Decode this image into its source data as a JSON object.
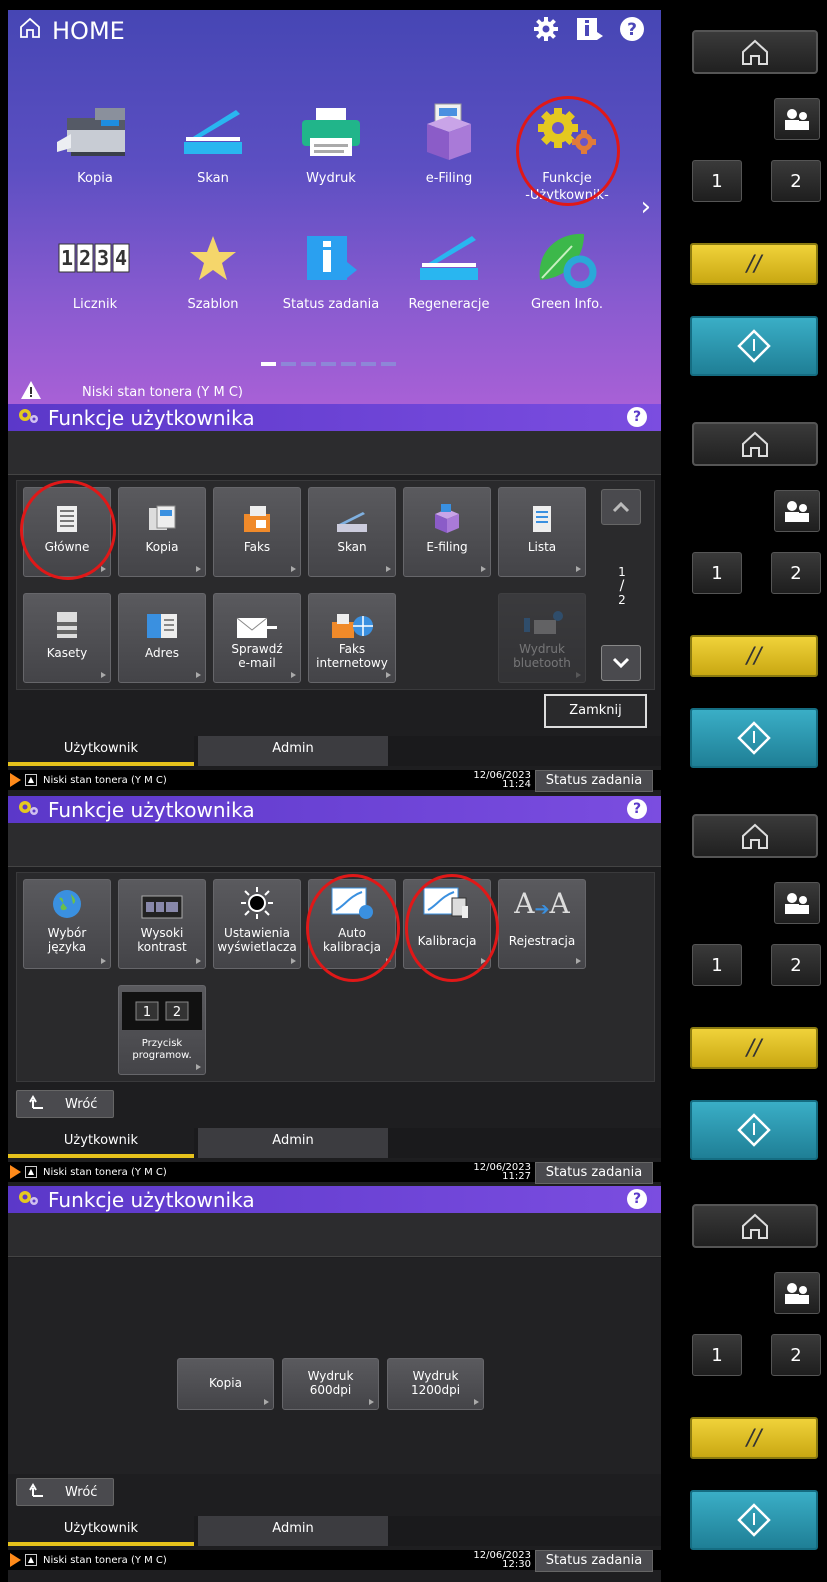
{
  "home": {
    "title": "HOME",
    "tiles": [
      {
        "label": "Kopia",
        "icon": "copier-icon"
      },
      {
        "label": "Skan",
        "icon": "scan-icon"
      },
      {
        "label": "Wydruk",
        "icon": "printer-icon"
      },
      {
        "label": "e-Filing",
        "icon": "efiling-box-icon"
      },
      {
        "label": "Funkcje\n-Użytkownik-",
        "icon": "user-functions-gears-icon"
      },
      {
        "label": "Licznik",
        "icon": "counter-1234-icon"
      },
      {
        "label": "Szablon",
        "icon": "star-icon"
      },
      {
        "label": "Status zadania",
        "icon": "info-icon"
      },
      {
        "label": "Regeneracje",
        "icon": "regenerate-scan-icon"
      },
      {
        "label": "Green Info.",
        "icon": "leaf-icon"
      }
    ],
    "warning": "Niski stan tonera (Y M C)",
    "page_dots": 7,
    "active_dot": 0
  },
  "panel_title": "Funkcje użytkownika",
  "panel1": {
    "buttons": [
      {
        "label": "Główne"
      },
      {
        "label": "Kopia"
      },
      {
        "label": "Faks"
      },
      {
        "label": "Skan"
      },
      {
        "label": "E-filing"
      },
      {
        "label": "Lista"
      },
      {
        "label": "Kasety"
      },
      {
        "label": "Adres"
      },
      {
        "label": "Sprawdź\ne-mail"
      },
      {
        "label": "Faks\ninternetowy"
      },
      {
        "label": "Wydruk\nbluetooth"
      }
    ],
    "page_current": "1",
    "page_total": "2",
    "close_label": "Zamknij",
    "time": "11:24"
  },
  "panel2": {
    "buttons": [
      {
        "label": "Wybór\njęzyka"
      },
      {
        "label": "Wysoki\nkontrast"
      },
      {
        "label": "Ustawienia\nwyświetlacza"
      },
      {
        "label": "Auto\nkalibracja"
      },
      {
        "label": "Kalibracja"
      },
      {
        "label": "Rejestracja"
      },
      {
        "label": "Przycisk\nprogramow."
      }
    ],
    "back_label": "Wróć",
    "time": "11:27"
  },
  "panel3": {
    "buttons": [
      {
        "label": "Kopia"
      },
      {
        "label": "Wydruk\n600dpi"
      },
      {
        "label": "Wydruk\n1200dpi"
      }
    ],
    "back_label": "Wróć",
    "time": "12:30"
  },
  "tabs": {
    "user": "Użytkownik",
    "admin": "Admin"
  },
  "status": {
    "message": "Niski stan tonera (Y M C)",
    "date": "12/06/2023",
    "job_status": "Status zadania"
  },
  "hardware": {
    "num1": "1",
    "num2": "2",
    "reset": "//"
  },
  "colors": {
    "accent_purple": "#5b38c9",
    "tab_underline": "#e6c21c",
    "highlight_red": "#e01818",
    "start_cyan": "#2a98b3"
  }
}
